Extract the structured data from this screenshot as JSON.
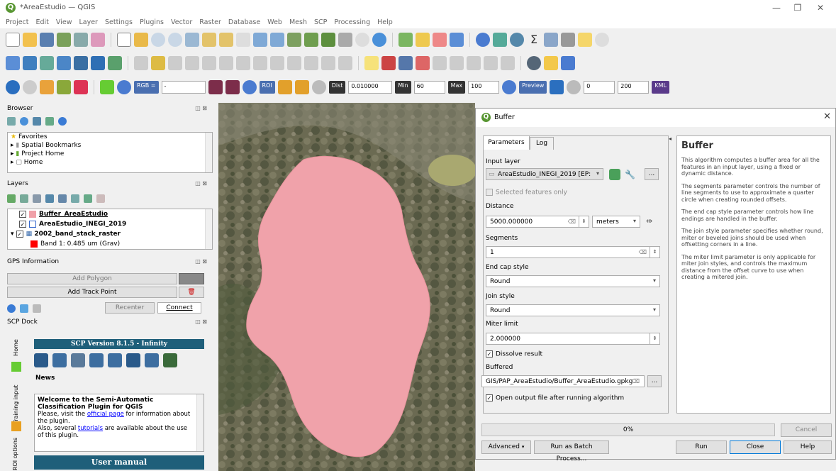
{
  "window": {
    "title": "*AreaEstudio — QGIS",
    "logo_letter": "Q"
  },
  "menu": [
    "Project",
    "Edit",
    "View",
    "Layer",
    "Settings",
    "Plugins",
    "Vector",
    "Raster",
    "Database",
    "Web",
    "Mesh",
    "SCP",
    "Processing",
    "Help"
  ],
  "scp_toolbar": {
    "rgb_label": "RGB =",
    "rgb_value": "-",
    "roi_label": "ROI",
    "dist_label": "Dist",
    "dist_value": "0.010000",
    "min_label": "Min",
    "min_value": "60",
    "max_label": "Max",
    "max_value": "100",
    "preview_label": "Preview",
    "t_value": "0",
    "s_value": "200",
    "kml_label": "KML"
  },
  "browser": {
    "title": "Browser",
    "items": [
      "Favorites",
      "Spatial Bookmarks",
      "Project Home",
      "Home"
    ]
  },
  "layers": {
    "title": "Layers",
    "items": [
      {
        "name": "Buffer_AreaEstudio",
        "color": "#f0a0a8"
      },
      {
        "name": "AreaEstudio_INEGI_2019",
        "color": "#ffffff"
      },
      {
        "name": "2002_band_stack_raster",
        "color": ""
      },
      {
        "name": "Band 1: 0.485 um (Grav)",
        "color": "#ff0000"
      }
    ]
  },
  "gps": {
    "title": "GPS Information",
    "add_polygon": "Add Polygon",
    "add_track_point": "Add Track Point",
    "recenter": "Recenter",
    "connect": "Connect"
  },
  "scp_dock": {
    "title": "SCP Dock",
    "version": "SCP Version 8.1.5 - Infinity",
    "news_label": "News",
    "welcome_title": "Welcome to the Semi-Automatic Classification Plugin for QGIS",
    "welcome_p1": "Please, visit the",
    "welcome_link": "official page",
    "welcome_p2": "for information about the plugin.",
    "welcome_p3": "Also, several",
    "tutorials_link": "tutorials",
    "welcome_p4": "are available about the use of this plugin.",
    "user_manual": "User manual",
    "side_tabs": [
      "Home",
      "Training input",
      "ROI options"
    ]
  },
  "dialog": {
    "title": "Buffer",
    "tabs": [
      "Parameters",
      "Log"
    ],
    "input_layer_label": "Input layer",
    "input_layer_value": "AreaEstudio_INEGI_2019 [EP:",
    "selected_only": "Selected features only",
    "distance_label": "Distance",
    "distance_value": "5000.000000",
    "distance_unit": "meters",
    "segments_label": "Segments",
    "segments_value": "1",
    "end_cap_label": "End cap style",
    "end_cap_value": "Round",
    "join_label": "Join style",
    "join_value": "Round",
    "miter_label": "Miter limit",
    "miter_value": "2.000000",
    "dissolve": "Dissolve result",
    "buffered_label": "Buffered",
    "buffered_value": "GIS/PAP_AreaEstudio/Buffer_AreaEstudio.gpkg",
    "open_output": "Open output file after running algorithm",
    "ellipsis": "...",
    "progress_text": "0%",
    "progress_fraction": 0,
    "cancel": "Cancel",
    "advanced": "Advanced",
    "batch": "Run as Batch Process...",
    "run": "Run",
    "close": "Close",
    "help": "Help",
    "help_title": "Buffer",
    "help_p1": "This algorithm computes a buffer area for all the features in an input layer, using a fixed or dynamic distance.",
    "help_p2": "The segments parameter controls the number of line segments to use to approximate a quarter circle when creating rounded offsets.",
    "help_p3": "The end cap style parameter controls how line endings are handled in the buffer.",
    "help_p4": "The join style parameter specifies whether round, miter or beveled joins should be used when offsetting corners in a line.",
    "help_p5": "The miter limit parameter is only applicable for miter join styles, and controls the maximum distance from the offset curve to use when creating a mitered join."
  }
}
